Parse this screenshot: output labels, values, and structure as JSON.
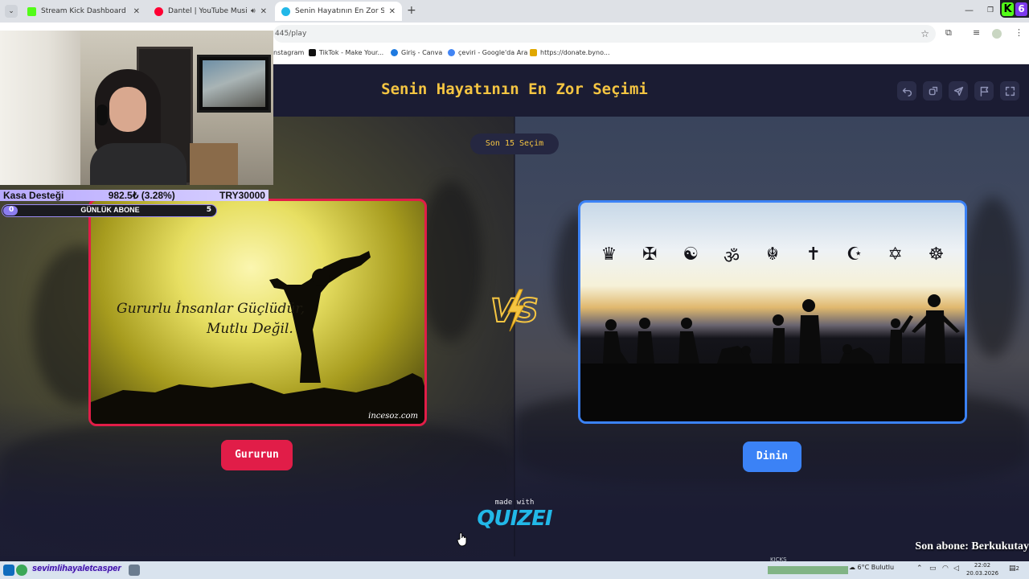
{
  "browser": {
    "tabs": [
      {
        "label": "Stream Kick Dashboard",
        "active": false,
        "favicon_color": "#53fc18"
      },
      {
        "label": "Dantel | YouTube Music",
        "active": false,
        "favicon_color": "#ff0033",
        "audio": true
      },
      {
        "label": "Senin Hayatının En Zor Seçimi",
        "active": true,
        "favicon_color": "#22b8e8"
      }
    ],
    "new_tab": "+",
    "url": "445/play",
    "bookmarks": [
      {
        "label": "nstagram",
        "favicon_color": "#d62976"
      },
      {
        "label": "TikTok - Make Your...",
        "favicon_color": "#111111"
      },
      {
        "label": "Giriş - Canva",
        "favicon_color": "#1f7ae0"
      },
      {
        "label": "çeviri - Google'da Ara",
        "favicon_color": "#4285f4"
      },
      {
        "label": "https://donate.byno...",
        "favicon_color": "#e0a800"
      }
    ],
    "kick_badge": {
      "letter": "K",
      "count": "6"
    }
  },
  "game": {
    "title": "Senin Hayatının En Zor Seçimi",
    "header_buttons": [
      "undo-icon",
      "share-icon",
      "send-icon",
      "flag-icon",
      "fullscreen-icon"
    ],
    "round_pill": "Son 15 Seçim",
    "left": {
      "quote_line1": "Gururlu İnsanlar Güçlüdür,",
      "quote_line2": "Mutlu Değil.",
      "watermark": "incesoz.com",
      "button": "Gururun",
      "accent": "#e11d48"
    },
    "right": {
      "symbols": [
        "♛",
        "✠",
        "☯",
        "ॐ",
        "☬",
        "✝",
        "☪",
        "✡",
        "☸"
      ],
      "button": "Dinin",
      "accent": "#3b82f6"
    },
    "vs_text": "VS",
    "made_with": "made with",
    "brand": "QUIZEI",
    "title_color": "#f5c542"
  },
  "overlay": {
    "kasa_label": "Kasa Desteği",
    "kasa_amount": "982.5₺ (3.28%)",
    "kasa_goal": "TRY30000",
    "abone_label": "GÜNLÜK ABONE",
    "abone_current": "0",
    "abone_target": "5",
    "abone_progress": 0.0,
    "son_abone": "Son abone: Berkukutay"
  },
  "taskbar": {
    "user": "sevimlihayaletcasper",
    "kicks": "KICKS",
    "weather": "6°C  Bulutlu",
    "time": "22:02",
    "date": "20.03.2026",
    "notifications": "2"
  }
}
